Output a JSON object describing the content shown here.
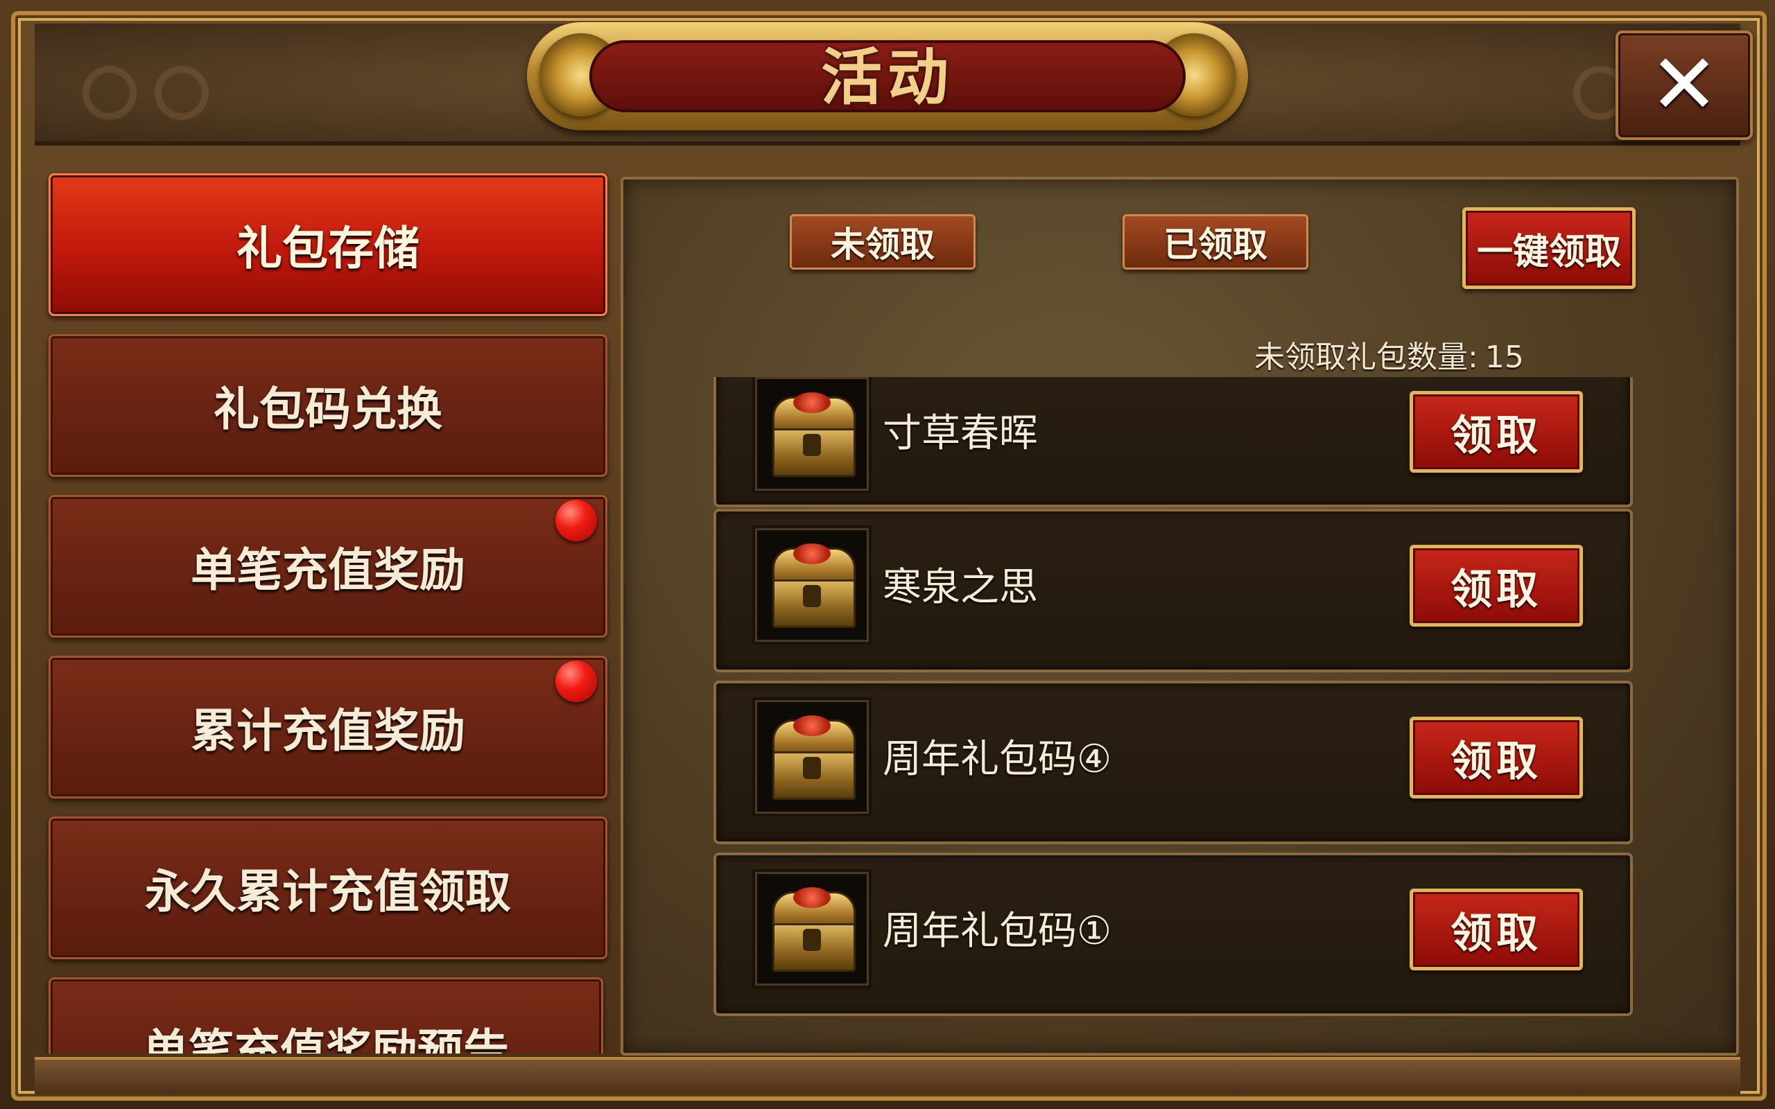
{
  "header": {
    "title": "活动",
    "close_icon": "close-x-icon"
  },
  "left_menu": {
    "items": [
      {
        "label": "礼包存储",
        "active": true,
        "badge": false
      },
      {
        "label": "礼包码兑换",
        "active": false,
        "badge": false
      },
      {
        "label": "单笔充值奖励",
        "active": false,
        "badge": true
      },
      {
        "label": "累计充值奖励",
        "active": false,
        "badge": true
      },
      {
        "label": "永久累计充值领取",
        "active": false,
        "badge": false
      },
      {
        "label": "单笔充值奖励预告",
        "active": false,
        "badge": false
      }
    ]
  },
  "panel": {
    "tab_unclaimed": "未领取",
    "tab_claimed": "已领取",
    "claim_all": "一键领取",
    "unclaimed_count_label": "未领取礼包数量:",
    "unclaimed_count_value": "15"
  },
  "gifts": [
    {
      "name": "寸草春晖",
      "button": "领取",
      "icon": "treasure-chest-icon"
    },
    {
      "name": "寒泉之思",
      "button": "领取",
      "icon": "treasure-chest-icon"
    },
    {
      "name": "周年礼包码④",
      "button": "领取",
      "icon": "treasure-chest-icon"
    },
    {
      "name": "周年礼包码①",
      "button": "领取",
      "icon": "treasure-chest-icon"
    }
  ],
  "colors": {
    "active_menu": "#c0180c",
    "menu": "#6a2412",
    "gold_border": "#e2b658",
    "panel_bg": "#4e3c22"
  }
}
